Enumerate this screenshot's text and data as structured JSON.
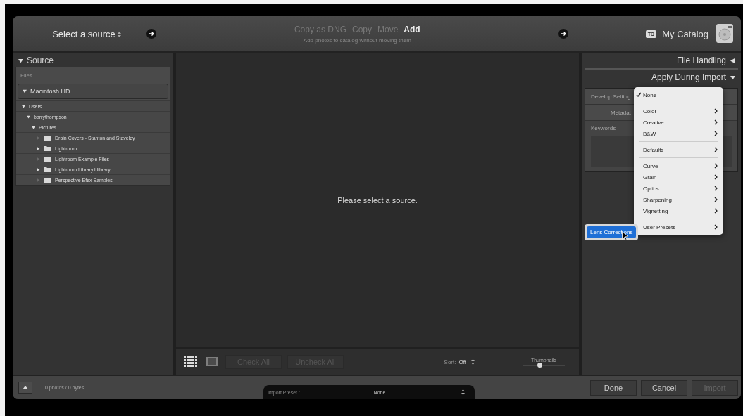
{
  "header": {
    "source_button": "Select a source",
    "modes": [
      {
        "label": "Copy as DNG",
        "selected": false
      },
      {
        "label": "Copy",
        "selected": false
      },
      {
        "label": "Move",
        "selected": false
      },
      {
        "label": "Add",
        "selected": true
      }
    ],
    "mode_description": "Add photos to catalog without moving them",
    "destination": {
      "badge": "TO",
      "label": "My Catalog"
    }
  },
  "source_panel": {
    "title": "Source",
    "section": "Files",
    "volume": "Macintosh HD",
    "tree": [
      {
        "label": "Users",
        "expanded": true,
        "children": [
          {
            "label": "barrythompson",
            "expanded": true,
            "children": [
              {
                "label": "Pictures",
                "expanded": true,
                "children": [
                  {
                    "label": "Drain Covers - Stanton and Staveley",
                    "has_children": false
                  },
                  {
                    "label": "Lightroom",
                    "has_children": true
                  },
                  {
                    "label": "Lightroom Example Files",
                    "has_children": false
                  },
                  {
                    "label": "Lightroom Library.lrlibrary",
                    "has_children": true
                  },
                  {
                    "label": "Perspective Efex Samples",
                    "has_children": false
                  }
                ]
              }
            ]
          }
        ]
      }
    ]
  },
  "center": {
    "message": "Please select a source.",
    "views": [
      {
        "kind": "grid",
        "selected": true
      },
      {
        "kind": "loupe",
        "selected": false
      }
    ],
    "check_all": "Check All",
    "uncheck_all": "Uncheck All",
    "sort_label": "Sort:",
    "sort_value": "Off",
    "thumbnails_label": "Thumbnails",
    "thumbnails": {
      "level": 0.4
    }
  },
  "right_panel": {
    "file_handling": "File Handling",
    "apply_during_import": "Apply During Import",
    "develop_settings_label": "Develop Setting",
    "metadata_label": "Metadat",
    "keywords_label": "Keywords"
  },
  "preset_menu": {
    "groups": [
      [
        {
          "label": "None",
          "checked": true,
          "submenu": false
        }
      ],
      [
        {
          "label": "Color",
          "checked": false,
          "submenu": true
        },
        {
          "label": "Creative",
          "checked": false,
          "submenu": true
        },
        {
          "label": "B&W",
          "checked": false,
          "submenu": true
        }
      ],
      [
        {
          "label": "Defaults",
          "checked": false,
          "submenu": true
        }
      ],
      [
        {
          "label": "Curve",
          "checked": false,
          "submenu": true
        },
        {
          "label": "Grain",
          "checked": false,
          "submenu": true
        },
        {
          "label": "Optics",
          "checked": false,
          "submenu": true
        },
        {
          "label": "Sharpening",
          "checked": false,
          "submenu": true
        },
        {
          "label": "Vignetting",
          "checked": false,
          "submenu": true
        }
      ],
      [
        {
          "label": "User Presets",
          "checked": false,
          "submenu": true
        }
      ]
    ],
    "hovered_item": "Lens Corrections"
  },
  "footer": {
    "count": "0 photos / 0 bytes",
    "import_preset_label": "Import Preset :",
    "import_preset_value": "None",
    "buttons": [
      {
        "label": "Done",
        "disabled": false
      },
      {
        "label": "Cancel",
        "disabled": false
      },
      {
        "label": "Import",
        "disabled": true
      }
    ]
  }
}
